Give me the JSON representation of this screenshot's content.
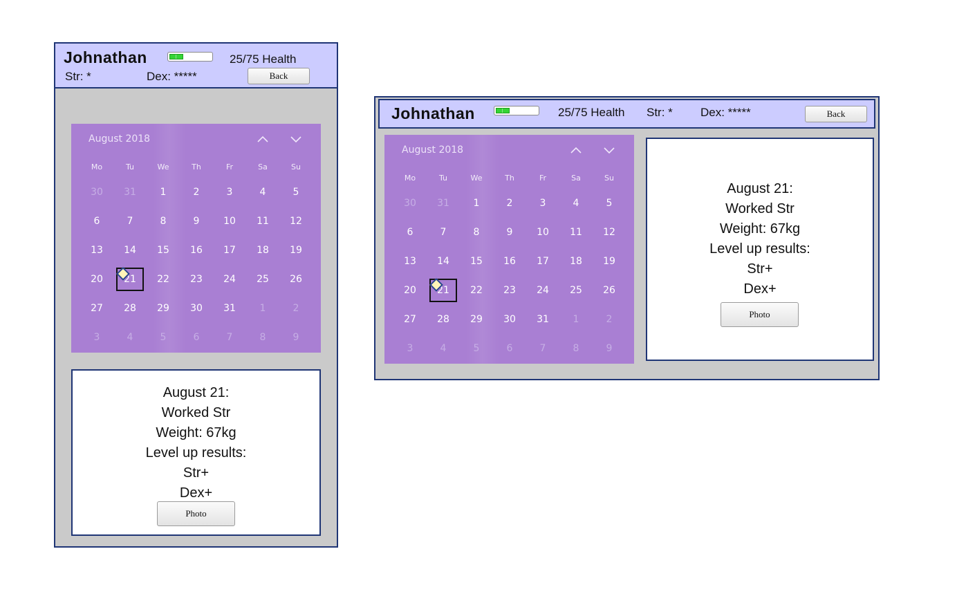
{
  "player": {
    "name": "Johnathan",
    "health_text": "25/75 Health",
    "health_current": 25,
    "health_max": 75,
    "str_text": "Str: *",
    "dex_text": "Dex: *****"
  },
  "buttons": {
    "back": "Back",
    "photo": "Photo"
  },
  "calendar": {
    "month_label": "August 2018",
    "weekdays": [
      "Mo",
      "Tu",
      "We",
      "Th",
      "Fr",
      "Sa",
      "Su"
    ],
    "weeks": [
      [
        "30",
        "31",
        "1",
        "2",
        "3",
        "4",
        "5"
      ],
      [
        "6",
        "7",
        "8",
        "9",
        "10",
        "11",
        "12"
      ],
      [
        "13",
        "14",
        "15",
        "16",
        "17",
        "18",
        "19"
      ],
      [
        "20",
        "21",
        "22",
        "23",
        "24",
        "25",
        "26"
      ],
      [
        "27",
        "28",
        "29",
        "30",
        "31",
        "1",
        "2"
      ],
      [
        "3",
        "4",
        "5",
        "6",
        "7",
        "8",
        "9"
      ]
    ],
    "dim_cells": [
      [
        0,
        0
      ],
      [
        0,
        1
      ],
      [
        4,
        5
      ],
      [
        4,
        6
      ],
      [
        5,
        0
      ],
      [
        5,
        1
      ],
      [
        5,
        2
      ],
      [
        5,
        3
      ],
      [
        5,
        4
      ],
      [
        5,
        5
      ],
      [
        5,
        6
      ]
    ],
    "selected_cell": [
      3,
      1
    ],
    "marked_cell": [
      3,
      1
    ]
  },
  "entry": {
    "lines": [
      "August 21:",
      "Worked Str",
      "Weight: 67kg",
      "Level up results:",
      "Str+",
      "Dex+"
    ]
  },
  "colors": {
    "header_bg": "#ccccff",
    "panel_bg": "#cacaca",
    "border": "#1f3575",
    "calendar_bg": "#a97fd3",
    "health_fill": "#35d435",
    "marker": "#fff5b8"
  }
}
